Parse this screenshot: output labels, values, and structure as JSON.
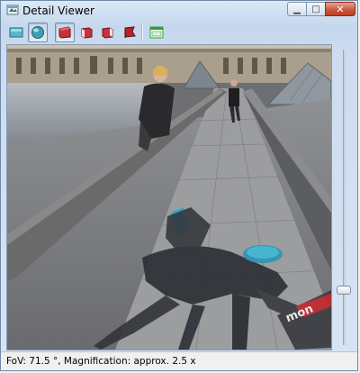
{
  "window": {
    "title": "Detail Viewer",
    "close_glyph": "✕",
    "minimize_glyph": "▁",
    "maximize_glyph": "□"
  },
  "toolbar": {
    "buttons": [
      {
        "name": "flat-view-icon",
        "pressed": false
      },
      {
        "name": "sphere-view-icon",
        "pressed": true
      },
      {
        "name": "red-cube-view-icon",
        "pressed": true
      },
      {
        "name": "red-cube-front-icon",
        "pressed": false
      },
      {
        "name": "red-cube-side-icon",
        "pressed": false
      },
      {
        "name": "red-flag-icon",
        "pressed": false
      },
      {
        "name": "window-layout-icon",
        "pressed": false
      }
    ]
  },
  "viewport": {
    "scene": "panorama-detail-photo",
    "zoom_slider_level": 0.18
  },
  "status": {
    "text": "FoV: 71.5 °, Magnification: approx. 2.5 x"
  },
  "colors": {
    "accent_red": "#c0272d",
    "accent_green": "#2f9e3b",
    "accent_teal": "#3aa7b8"
  }
}
